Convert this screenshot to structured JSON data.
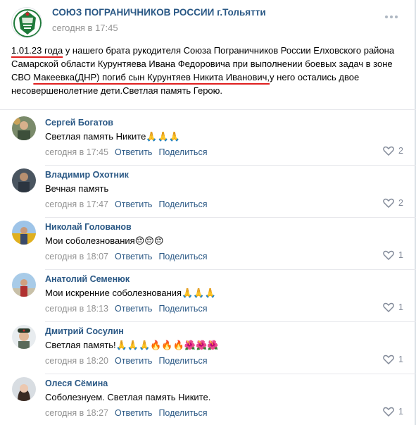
{
  "post": {
    "group_name": "СОЮЗ ПОГРАНИЧНИКОВ РОССИИ г.Тольятти",
    "date": "сегодня в 17:45",
    "text_part1": "1.01.23 года",
    "text_part2": " у нашего брата рукодителя Союза Пограничников России Елховского района Самарской области Курунтяева Ивана Федоровича при выполнении боевых задач в зоне СВО ",
    "text_part3": "Макеевка(ДНР) погиб сын Курунтяев Никита Иванович,",
    "text_part4": "у него остались двое несовершенолетние дети.Светлая память Герою."
  },
  "labels": {
    "reply": "Ответить",
    "share": "Поделиться"
  },
  "comments": [
    {
      "author": "Сергей Богатов",
      "text": "Светлая память Никите🙏🙏🙏",
      "time": "сегодня в 17:45",
      "likes": "2"
    },
    {
      "author": "Владимир Охотник",
      "text": "Вечная память",
      "time": "сегодня в 17:47",
      "likes": "2"
    },
    {
      "author": "Николай Голованов",
      "text": "Мои соболезнования😔😔😔",
      "time": "сегодня в 18:07",
      "likes": "1"
    },
    {
      "author": "Анатолий Семенюк",
      "text": "Мои искренние соболезнования🙏🙏🙏",
      "time": "сегодня в 18:13",
      "likes": "1"
    },
    {
      "author": "Дмитрий Сосулин",
      "text": "Светлая память!🙏🙏🙏🔥🔥🔥🌺🌺🌺",
      "time": "сегодня в 18:20",
      "likes": "1"
    },
    {
      "author": "Олеся Сёмина",
      "text": "Соболезнуем. Светлая память Никите.",
      "time": "сегодня в 18:27",
      "likes": "1"
    }
  ],
  "colors": {
    "link": "#2a5885",
    "meta": "#939393",
    "underline": "#e02020"
  }
}
